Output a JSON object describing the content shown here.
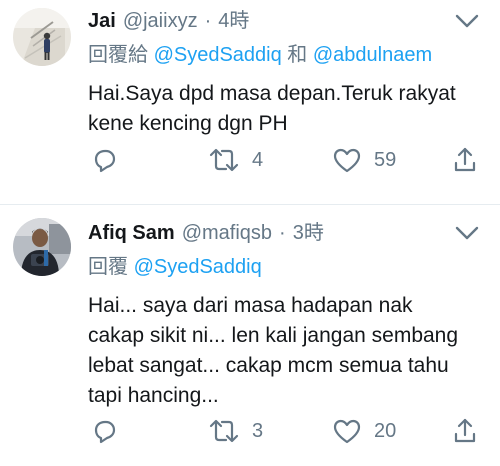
{
  "tweets": [
    {
      "display_name": "Jai",
      "handle": "@jaiixyz",
      "separator": "·",
      "time": "4時",
      "reply_prefix": "回覆給",
      "mentions": [
        "@SyedSaddiq",
        "@abdulnaem"
      ],
      "reply_joiner": "和",
      "text": "Hai.Saya dpd masa depan.Teruk rakyat\nkene kencing dgn PH",
      "retweets": "4",
      "likes": "59",
      "avatar": "avatar-photo-figure-by-stairs"
    },
    {
      "display_name": "Afiq Sam",
      "handle": "@mafiqsb",
      "separator": "·",
      "time": "3時",
      "reply_prefix": "回覆",
      "mentions": [
        "@SyedSaddiq"
      ],
      "text": "Hai... saya dari masa hadapan nak\ncakap sikit ni... len kali jangan sembang\nlebat sangat... cakap mcm semua tahu\ntapi hancing...",
      "retweets": "3",
      "likes": "20",
      "avatar": "avatar-photo-man-with-camera"
    }
  ],
  "colors": {
    "accent": "#1da1f2",
    "secondary_text": "#657786",
    "primary_text": "#14171a",
    "divider": "#e6ecf0"
  },
  "icons": [
    "chevron-down-icon",
    "reply-icon",
    "retweet-icon",
    "like-icon",
    "share-icon"
  ]
}
